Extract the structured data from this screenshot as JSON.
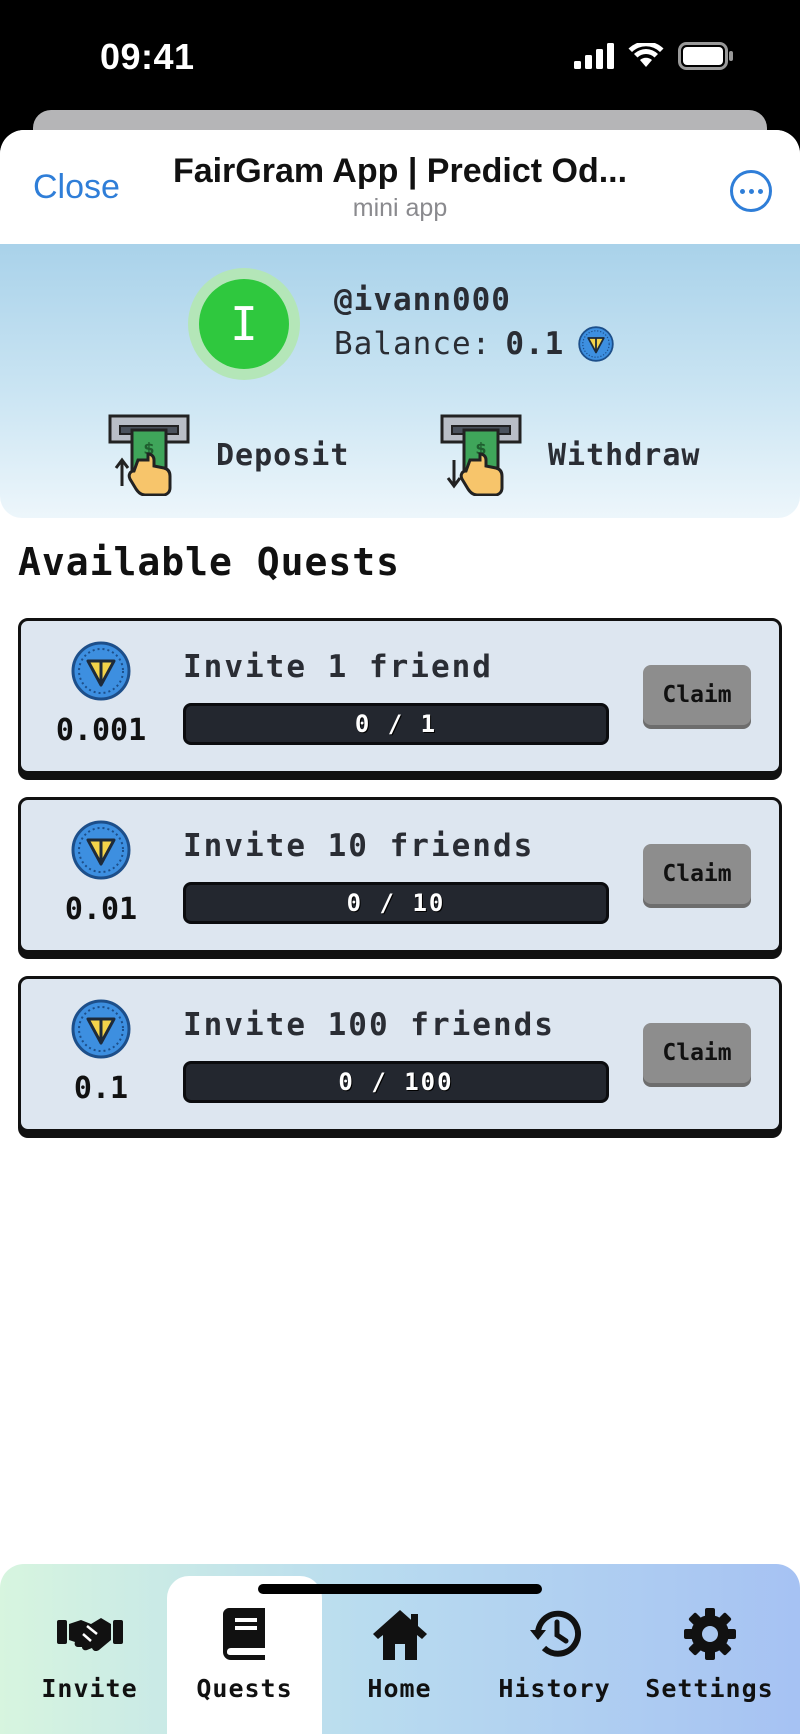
{
  "status_bar": {
    "time": "09:41"
  },
  "header": {
    "close_label": "Close",
    "title": "FairGram App | Predict Od...",
    "subtitle": "mini app",
    "more_icon": "more-horizontal-icon"
  },
  "profile": {
    "avatar_letter": "I",
    "username": "@ivann000",
    "balance_label": "Balance:",
    "balance_value": "0.1",
    "currency_icon": "ton-coin-icon",
    "deposit_label": "Deposit",
    "withdraw_label": "Withdraw"
  },
  "quests_title": "Available Quests",
  "quests": [
    {
      "reward": "0.001",
      "title": "Invite 1 friend",
      "progress": "0 / 1",
      "progress_fraction": 0,
      "claim_label": "Claim"
    },
    {
      "reward": "0.01",
      "title": "Invite 10 friends",
      "progress": "0 / 10",
      "progress_fraction": 0,
      "claim_label": "Claim"
    },
    {
      "reward": "0.1",
      "title": "Invite 100 friends",
      "progress": "0 / 100",
      "progress_fraction": 0,
      "claim_label": "Claim"
    }
  ],
  "tabs": [
    {
      "label": "Invite",
      "icon": "handshake-icon"
    },
    {
      "label": "Quests",
      "icon": "book-icon",
      "active": true
    },
    {
      "label": "Home",
      "icon": "home-icon"
    },
    {
      "label": "History",
      "icon": "history-icon"
    },
    {
      "label": "Settings",
      "icon": "gear-icon"
    }
  ],
  "colors": {
    "accent_blue": "#2f7ed8",
    "avatar_green": "#2fc83e",
    "ton_blue": "#3d8fe0",
    "ton_yellow": "#f3d34a",
    "claim_gray": "#8d8d8d"
  }
}
